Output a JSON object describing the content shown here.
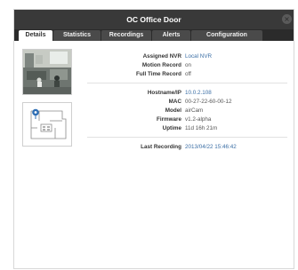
{
  "window": {
    "title": "OC Office Door",
    "close_glyph": "×"
  },
  "tabs": [
    {
      "label": "Details",
      "active": true
    },
    {
      "label": "Statistics",
      "active": false
    },
    {
      "label": "Recordings",
      "active": false
    },
    {
      "label": "Alerts",
      "active": false
    },
    {
      "label": "Configuration",
      "active": false
    }
  ],
  "recording": {
    "assigned_nvr_label": "Assigned NVR",
    "assigned_nvr_value": "Local NVR",
    "motion_record_label": "Motion Record",
    "motion_record_value": "on",
    "full_time_record_label": "Full Time Record",
    "full_time_record_value": "off"
  },
  "device": {
    "hostname_label": "Hostname/IP",
    "hostname_value": "10.0.2.108",
    "mac_label": "MAC",
    "mac_value": "00-27-22-60-00-12",
    "model_label": "Model",
    "model_value": "airCam",
    "firmware_label": "Firmware",
    "firmware_value": "v1.2-alpha",
    "uptime_label": "Uptime",
    "uptime_value": "11d 16h 21m"
  },
  "last_recording": {
    "label": "Last Recording",
    "value": "2013/04/22 15:46:42"
  },
  "colors": {
    "title_bar": "#393939",
    "tab_bar": "#2b2b2b",
    "link": "#3b6ea5",
    "camera_marker": "#2f6fb5"
  },
  "icons": {
    "camera_marker": "camera-location-pin-icon",
    "close": "close-icon"
  }
}
